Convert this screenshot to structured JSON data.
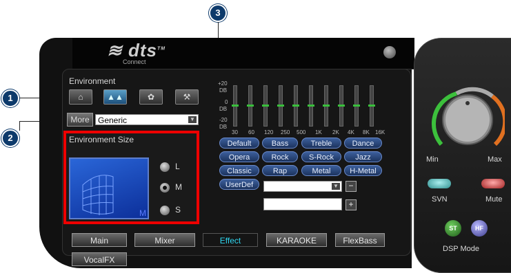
{
  "callouts": [
    "1",
    "2",
    "3"
  ],
  "logo": {
    "brand": "dts",
    "tm": "TM",
    "sub": "Connect"
  },
  "environment": {
    "label": "Environment",
    "more_label": "More",
    "selected": "Generic",
    "size_label": "Environment Size",
    "room_size_letter": "M",
    "size_options": [
      "L",
      "M",
      "S"
    ],
    "selected_size": "M"
  },
  "eq": {
    "scale": [
      "+20",
      "DB",
      "0",
      "DB",
      "-20",
      "DB"
    ],
    "freqs": [
      "30",
      "60",
      "120",
      "250",
      "500",
      "1K",
      "2K",
      "4K",
      "8K",
      "16K"
    ],
    "presets": [
      "Default",
      "Bass",
      "Treble",
      "Dance",
      "Opera",
      "Rock",
      "S-Rock",
      "Jazz",
      "Classic",
      "Rap",
      "Metal",
      "H-Metal"
    ],
    "userdef_label": "UserDef",
    "minus_label": "−",
    "plus_label": "+"
  },
  "tabs": [
    "Main",
    "Mixer",
    "Effect",
    "KARAOKE",
    "FlexBass",
    "VocalFX"
  ],
  "active_tab": "Effect",
  "right": {
    "knob_min": "Min",
    "knob_max": "Max",
    "svn_label": "SVN",
    "mute_label": "Mute",
    "dsp_label": "DSP Mode",
    "dsp_buttons": [
      "ST",
      "HF"
    ]
  },
  "colors": {
    "highlight_box": "#e00000",
    "callout": "#0d3a6b",
    "active_tab_text": "#2fd6f0"
  }
}
